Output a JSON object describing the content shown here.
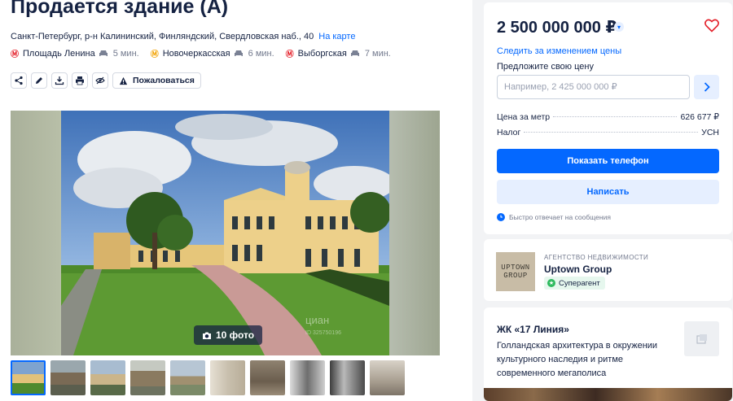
{
  "listing": {
    "title": "Продается здание (A)",
    "address": "Санкт-Петербург, р-н Калининский, Финляндский, Свердловская наб., 40",
    "map_link": "На карте",
    "metro": [
      {
        "name": "Площадь Ленина",
        "time": "5 мин.",
        "color": "#e4202a"
      },
      {
        "name": "Новочеркасская",
        "time": "6 мин.",
        "color": "#f2a202"
      },
      {
        "name": "Выборгская",
        "time": "7 мин.",
        "color": "#e4202a"
      }
    ],
    "metro_icon": "Ⓜ",
    "complain_label": "Пожаловаться"
  },
  "gallery": {
    "photo_count": "10 фото",
    "watermark": "циан",
    "watermark_id": "ID 325750196"
  },
  "price_card": {
    "price": "2 500 000 000 ₽",
    "follow_link": "Следить за изменением цены",
    "offer_label": "Предложите свою цену",
    "offer_placeholder": "Например, 2 425 000 000 ₽",
    "rows": [
      {
        "label": "Цена за метр",
        "value": "626 677 ₽"
      },
      {
        "label": "Налог",
        "value": "УСН"
      }
    ],
    "show_phone": "Показать телефон",
    "write": "Написать",
    "fast_reply": "Быстро отвечает на сообщения"
  },
  "agency": {
    "type": "АГЕНТСТВО НЕДВИЖИМОСТИ",
    "name": "Uptown Group",
    "badge": "Суперагент",
    "logo_text": "UPTOWN\nGROUP"
  },
  "complex": {
    "name": "ЖК «17 Линия»",
    "description": "Голландская архитектура в окружении культурного наследия и ритме современного мегаполиса"
  },
  "colors": {
    "accent": "#0468ff",
    "text": "#152242",
    "muted": "#737a8e",
    "heart": "#e4202a",
    "super": "#2dba5e"
  }
}
